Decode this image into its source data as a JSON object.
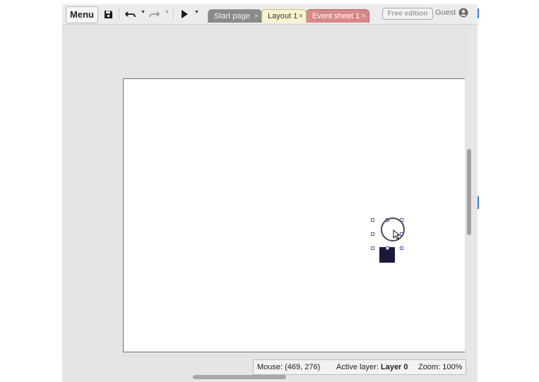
{
  "toolbar": {
    "menu_label": "Menu",
    "icons": [
      "save-icon",
      "undo-icon",
      "redo-icon",
      "play-icon"
    ]
  },
  "tabs": [
    {
      "label": "Start page",
      "state": "inactive",
      "color": "#8a8a8a"
    },
    {
      "label": "Layout 1",
      "state": "active",
      "color": "#fbf3cf"
    },
    {
      "label": "Event sheet 1",
      "state": "inactive",
      "color": "#d9888a"
    }
  ],
  "tab_close_glyph": "×",
  "edition_label": "Free edition",
  "user_label": "Guest",
  "status": {
    "mouse_label": "Mouse:",
    "mouse_value": "(469, 276)",
    "layer_label": "Active layer:",
    "layer_value": "Layer 0",
    "zoom_label": "Zoom:",
    "zoom_value": "100%"
  },
  "colors": {
    "sprite": "#1c1a3a",
    "selection_handle": "#5b5fa8",
    "layout_bg": "#ffffff",
    "viewport_bg": "#e4e4e4"
  }
}
